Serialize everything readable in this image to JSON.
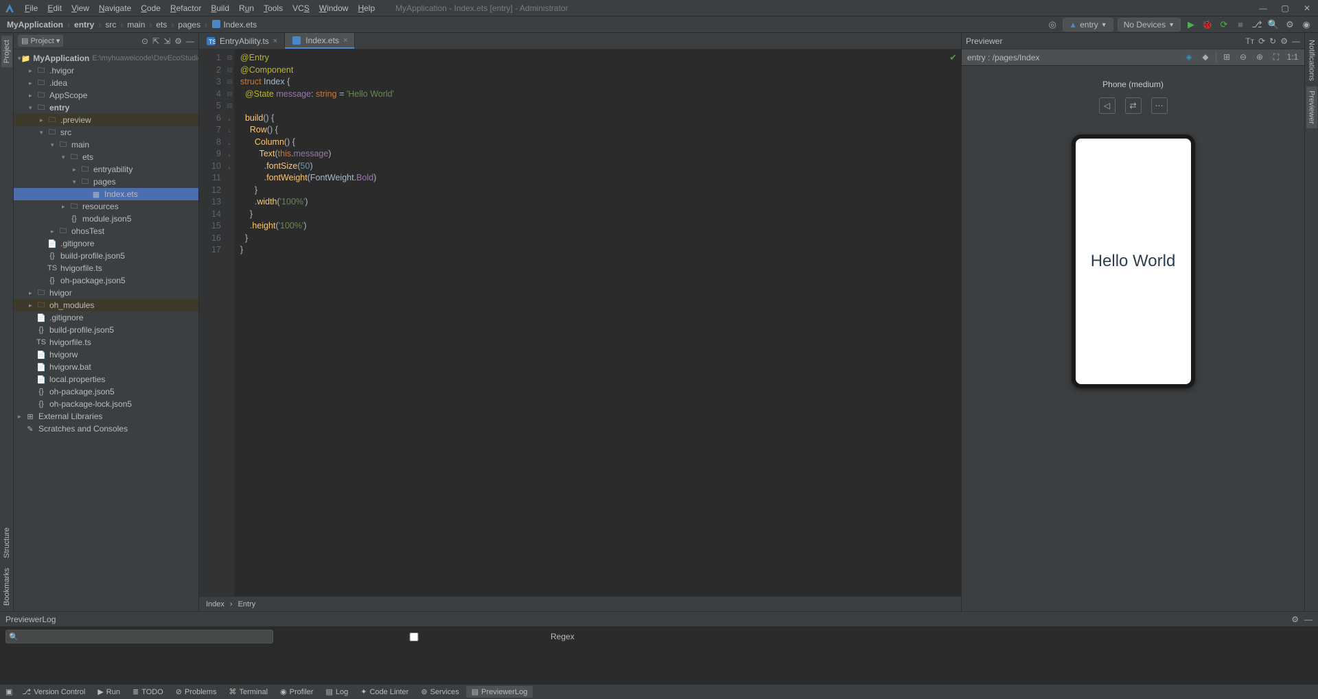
{
  "window": {
    "title": "MyApplication - Index.ets [entry] - Administrator"
  },
  "menu": [
    "File",
    "Edit",
    "View",
    "Navigate",
    "Code",
    "Refactor",
    "Build",
    "Run",
    "Tools",
    "VCS",
    "Window",
    "Help"
  ],
  "breadcrumb": [
    "MyApplication",
    "entry",
    "src",
    "main",
    "ets",
    "pages",
    "Index.ets"
  ],
  "runConfig": {
    "name": "entry",
    "devices": "No Devices"
  },
  "projectPanel": {
    "title": "Project",
    "rootName": "MyApplication",
    "rootPath": "E:\\myhuaweicode\\DevEcoStudioPro"
  },
  "tree": [
    {
      "d": 0,
      "expand": "v",
      "icon": "proj",
      "label": "MyApplication",
      "bold": true,
      "path": "E:\\myhuaweicode\\DevEcoStudioPro"
    },
    {
      "d": 1,
      "expand": ">",
      "icon": "folder",
      "label": ".hvigor"
    },
    {
      "d": 1,
      "expand": ">",
      "icon": "folder",
      "label": ".idea"
    },
    {
      "d": 1,
      "expand": ">",
      "icon": "folder",
      "label": "AppScope"
    },
    {
      "d": 1,
      "expand": "v",
      "icon": "folder",
      "label": "entry",
      "bold": true
    },
    {
      "d": 2,
      "expand": ">",
      "icon": "folder-o",
      "label": ".preview",
      "hl": true
    },
    {
      "d": 2,
      "expand": "v",
      "icon": "folder",
      "label": "src"
    },
    {
      "d": 3,
      "expand": "v",
      "icon": "folder",
      "label": "main"
    },
    {
      "d": 4,
      "expand": "v",
      "icon": "folder",
      "label": "ets"
    },
    {
      "d": 5,
      "expand": ">",
      "icon": "folder",
      "label": "entryability"
    },
    {
      "d": 5,
      "expand": "v",
      "icon": "folder",
      "label": "pages"
    },
    {
      "d": 6,
      "expand": "",
      "icon": "ets",
      "label": "Index.ets",
      "selected": true
    },
    {
      "d": 4,
      "expand": ">",
      "icon": "folder",
      "label": "resources"
    },
    {
      "d": 4,
      "expand": "",
      "icon": "json",
      "label": "module.json5"
    },
    {
      "d": 3,
      "expand": ">",
      "icon": "folder",
      "label": "ohosTest"
    },
    {
      "d": 2,
      "expand": "",
      "icon": "file",
      "label": ".gitignore"
    },
    {
      "d": 2,
      "expand": "",
      "icon": "json",
      "label": "build-profile.json5"
    },
    {
      "d": 2,
      "expand": "",
      "icon": "ts",
      "label": "hvigorfile.ts"
    },
    {
      "d": 2,
      "expand": "",
      "icon": "json",
      "label": "oh-package.json5"
    },
    {
      "d": 1,
      "expand": ">",
      "icon": "folder",
      "label": "hvigor"
    },
    {
      "d": 1,
      "expand": ">",
      "icon": "folder-o",
      "label": "oh_modules",
      "hl": true
    },
    {
      "d": 1,
      "expand": "",
      "icon": "file",
      "label": ".gitignore"
    },
    {
      "d": 1,
      "expand": "",
      "icon": "json",
      "label": "build-profile.json5"
    },
    {
      "d": 1,
      "expand": "",
      "icon": "ts",
      "label": "hvigorfile.ts"
    },
    {
      "d": 1,
      "expand": "",
      "icon": "file",
      "label": "hvigorw"
    },
    {
      "d": 1,
      "expand": "",
      "icon": "file",
      "label": "hvigorw.bat"
    },
    {
      "d": 1,
      "expand": "",
      "icon": "file",
      "label": "local.properties"
    },
    {
      "d": 1,
      "expand": "",
      "icon": "json",
      "label": "oh-package.json5"
    },
    {
      "d": 1,
      "expand": "",
      "icon": "json",
      "label": "oh-package-lock.json5"
    },
    {
      "d": 0,
      "expand": ">",
      "icon": "lib",
      "label": "External Libraries"
    },
    {
      "d": 0,
      "expand": "",
      "icon": "scratch",
      "label": "Scratches and Consoles"
    }
  ],
  "editorTabs": [
    {
      "name": "EntryAbility.ts",
      "active": false
    },
    {
      "name": "Index.ets",
      "active": true
    }
  ],
  "code": {
    "lines": 17,
    "crumbs": [
      "Index",
      "Entry"
    ]
  },
  "previewer": {
    "title": "Previewer",
    "entry": "entry : /pages/Index",
    "device": "Phone (medium)",
    "hello": "Hello World"
  },
  "bottomPanel": {
    "title": "PreviewerLog",
    "searchPlaceholder": "",
    "regex": "Regex"
  },
  "statusbar": [
    {
      "icon": "⎇",
      "label": "Version Control"
    },
    {
      "icon": "▶",
      "label": "Run"
    },
    {
      "icon": "≣",
      "label": "TODO"
    },
    {
      "icon": "⊘",
      "label": "Problems"
    },
    {
      "icon": "⌘",
      "label": "Terminal"
    },
    {
      "icon": "◉",
      "label": "Profiler"
    },
    {
      "icon": "▤",
      "label": "Log"
    },
    {
      "icon": "✦",
      "label": "Code Linter"
    },
    {
      "icon": "⊚",
      "label": "Services"
    },
    {
      "icon": "▤",
      "label": "PreviewerLog",
      "active": true
    }
  ]
}
